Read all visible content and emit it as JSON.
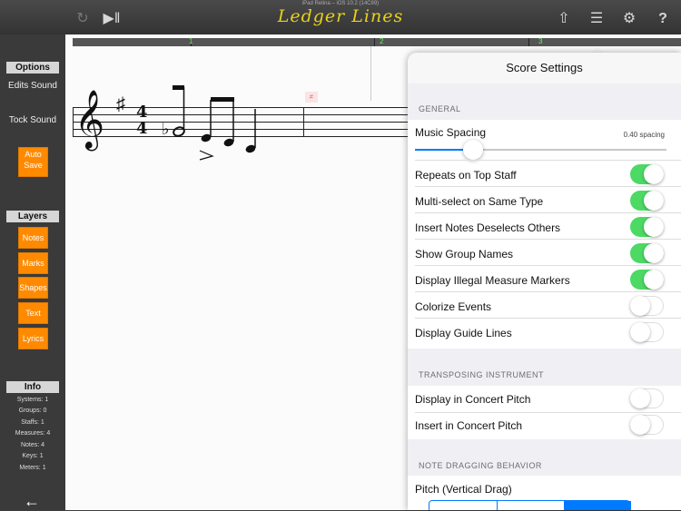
{
  "status_bar": "iPad Retina – iOS 10.2 (14C89)",
  "app_title": "Ledger Lines",
  "toolbar_icons": [
    "redo-icon",
    "play-pause-icon",
    "share-icon",
    "mixer-sliders-icon",
    "gear-icon",
    "help-icon"
  ],
  "toolbar": {
    "help_label": "?"
  },
  "sidebar": {
    "options_header": "Options",
    "edits_sound": "Edits Sound",
    "tock_sound": "Tock Sound",
    "auto_save": "Auto Save",
    "layers_header": "Layers",
    "layers": [
      "Notes",
      "Marks",
      "Shapes",
      "Text",
      "Lyrics"
    ],
    "info_header": "Info",
    "info": [
      "Systems: 1",
      "Groups: 0",
      "Staffs: 1",
      "Measures: 4",
      "Notes: 4",
      "Keys: 1",
      "Meters: 1"
    ],
    "back_label": "←"
  },
  "ruler": [
    "1",
    "2",
    "3"
  ],
  "score": {
    "time_top": "4",
    "time_bottom": "4",
    "measure_marker": "≠"
  },
  "settings": {
    "title": "Score Settings",
    "general_header": "GENERAL",
    "music_spacing_label": "Music Spacing",
    "music_spacing_value": "0.40 spacing",
    "music_spacing_fraction": 0.23,
    "toggles": [
      {
        "label": "Repeats on Top Staff",
        "on": true
      },
      {
        "label": "Multi-select on Same Type",
        "on": true
      },
      {
        "label": "Insert Notes Deselects Others",
        "on": true
      },
      {
        "label": "Show Group Names",
        "on": true
      },
      {
        "label": "Display Illegal Measure Markers",
        "on": true
      },
      {
        "label": "Colorize Events",
        "on": false
      },
      {
        "label": "Display Guide Lines",
        "on": false
      }
    ],
    "transposing_header": "TRANSPOSING INSTRUMENT",
    "transposing": [
      {
        "label": "Display in Concert Pitch",
        "on": false
      },
      {
        "label": "Insert in Concert Pitch",
        "on": false
      }
    ],
    "dragging_header": "NOTE DRAGGING BEHAVIOR",
    "pitch_label": "Pitch (Vertical Drag)"
  },
  "colors": {
    "accent": "#ff8a00",
    "switch_on": "#4cd964",
    "title": "#e6d21a"
  }
}
